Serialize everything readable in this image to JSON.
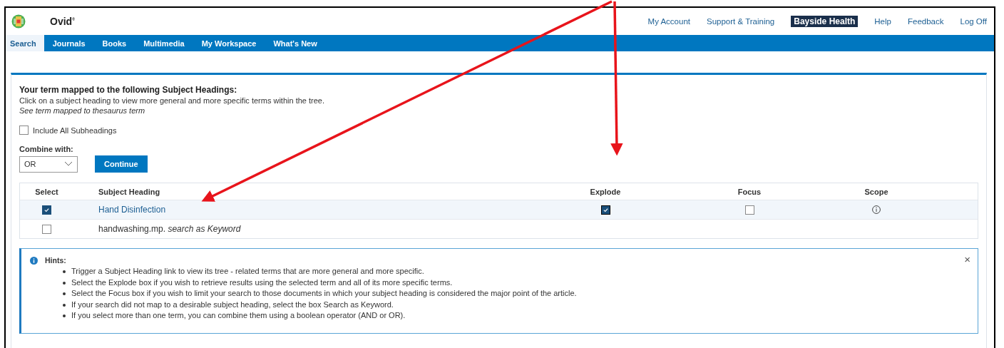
{
  "header": {
    "brand": "Ovid$^{®}$",
    "links": [
      {
        "label": "My Account",
        "kind": "link"
      },
      {
        "label": "Support & Training",
        "kind": "link"
      },
      {
        "label": "Bayside Health",
        "kind": "institution"
      },
      {
        "label": "Help",
        "kind": "link"
      },
      {
        "label": "Feedback",
        "kind": "link"
      },
      {
        "label": "Log Off",
        "kind": "link"
      }
    ]
  },
  "tabs": [
    {
      "label": "Search",
      "selected": true
    },
    {
      "label": "Journals",
      "selected": false
    },
    {
      "label": "Books",
      "selected": false
    },
    {
      "label": "Multimedia",
      "selected": false
    },
    {
      "label": "My Workspace",
      "selected": false
    },
    {
      "label": "What's New",
      "selected": false
    }
  ],
  "panel": {
    "title": "Your term mapped to the following Subject Headings:",
    "description": "Click on a subject heading to view more general and more specific terms within the tree.",
    "note": "See term mapped to thesaurus term",
    "include_subheadings": {
      "label": "Include All Subheadings",
      "checked": false
    },
    "combine": {
      "label": "Combine with:",
      "value": "OR"
    },
    "continue_button": "Continue"
  },
  "table": {
    "columns": [
      "Select",
      "Subject Heading",
      "Explode",
      "Focus",
      "Scope"
    ],
    "rows": [
      {
        "kind": "heading",
        "selected": true,
        "heading": "Hand Disinfection",
        "explode": true,
        "focus": false
      },
      {
        "kind": "keyword",
        "selected": false,
        "heading": "handwashing.mp. *search as Keyword*"
      }
    ]
  },
  "hints": {
    "title": "Hints:",
    "close": "×",
    "items": [
      "Trigger a Subject Heading link to view its tree - related terms that are more general and more specific.",
      "Select the Explode box if you wish to retrieve results using the selected term and all of its more specific terms.",
      "Select the Focus box if you wish to limit your search to those documents in which your subject heading is considered the major point of the article.",
      "If your search did not map to a desirable subject heading, select the box Search as Keyword.",
      "If you select more than one term, you can combine them using a boolean operator (AND or OR)."
    ]
  }
}
